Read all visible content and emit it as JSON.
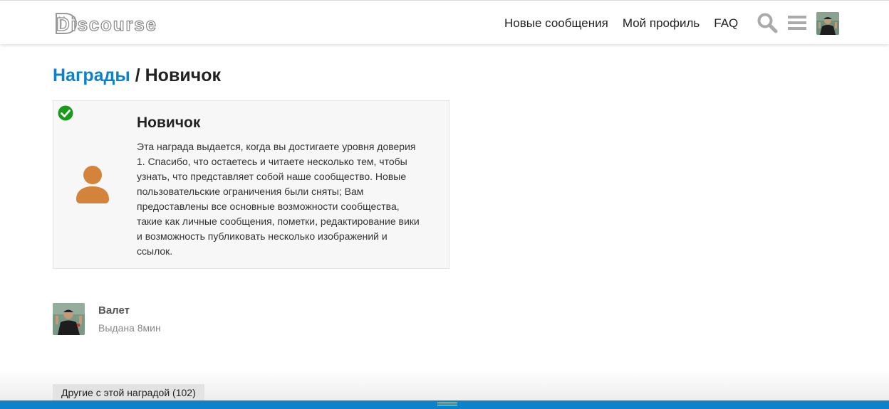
{
  "header": {
    "logo_text": "Discourse",
    "nav": [
      "Новые сообщения",
      "Мой профиль",
      "FAQ"
    ],
    "icons": [
      "search-icon",
      "hamburger-menu-icon"
    ]
  },
  "breadcrumb": {
    "parent": "Награды",
    "separator": "/",
    "current": "Новичок"
  },
  "badge": {
    "name": "Новичок",
    "description": "Эта награда выдается, когда вы достигаете уровня доверия 1. Спасибо, что остаетесь и читаете несколько тем, чтобы узнать, что представляет собой наше сообщество. Новые пользовательские ограничения были сняты; Вам предоставлены все основные возможности сообщества, такие как личные сообщения, пометки, редактирование вики и возможность публиковать несколько изображений и ссылок.",
    "icon": "user-icon",
    "icon_color": "#d4843a",
    "granted_check_color": "#1a9a1a"
  },
  "grant": {
    "user": "Валет",
    "time": "Выдана 8мин"
  },
  "others_button": "Другие с этой наградой (102)",
  "colors": {
    "accent": "#0d82c9"
  }
}
